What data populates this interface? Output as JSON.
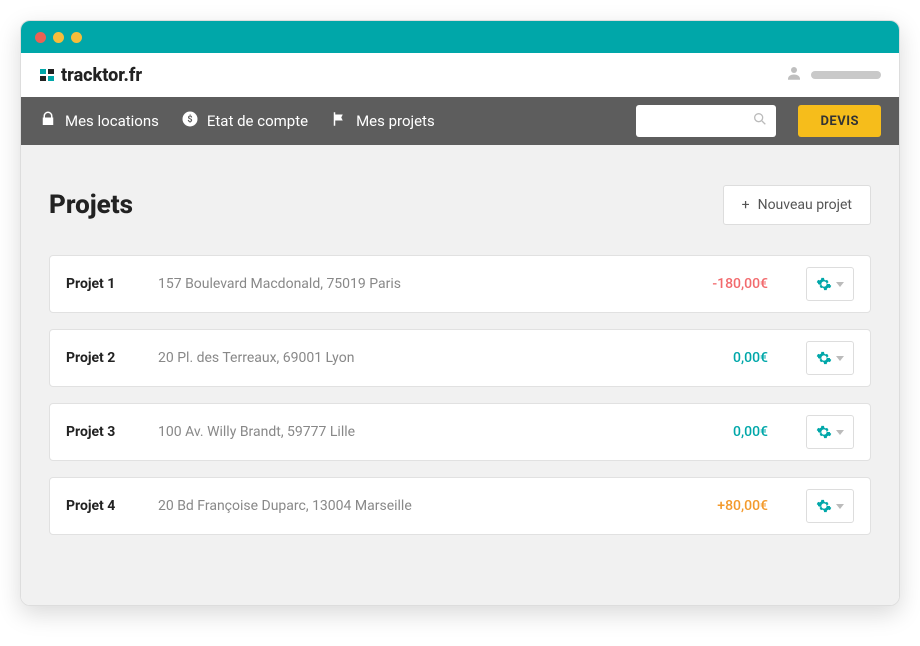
{
  "brand": "tracktor.fr",
  "nav": {
    "locations": "Mes locations",
    "account": "Etat de compte",
    "projects": "Mes projets",
    "devis": "DEVIS"
  },
  "page": {
    "title": "Projets",
    "new_project": "Nouveau projet"
  },
  "projects": [
    {
      "name": "Projet 1",
      "address": "157 Boulevard Macdonald, 75019 Paris",
      "amount": "-180,00€",
      "amount_class": "amt-neg"
    },
    {
      "name": "Projet 2",
      "address": "20 Pl. des Terreaux, 69001 Lyon",
      "amount": "0,00€",
      "amount_class": "amt-zero"
    },
    {
      "name": "Projet 3",
      "address": "100 Av. Willy Brandt, 59777 Lille",
      "amount": "0,00€",
      "amount_class": "amt-zero"
    },
    {
      "name": "Projet 4",
      "address": "20 Bd Françoise Duparc, 13004 Marseille",
      "amount": "+80,00€",
      "amount_class": "amt-pos"
    }
  ]
}
